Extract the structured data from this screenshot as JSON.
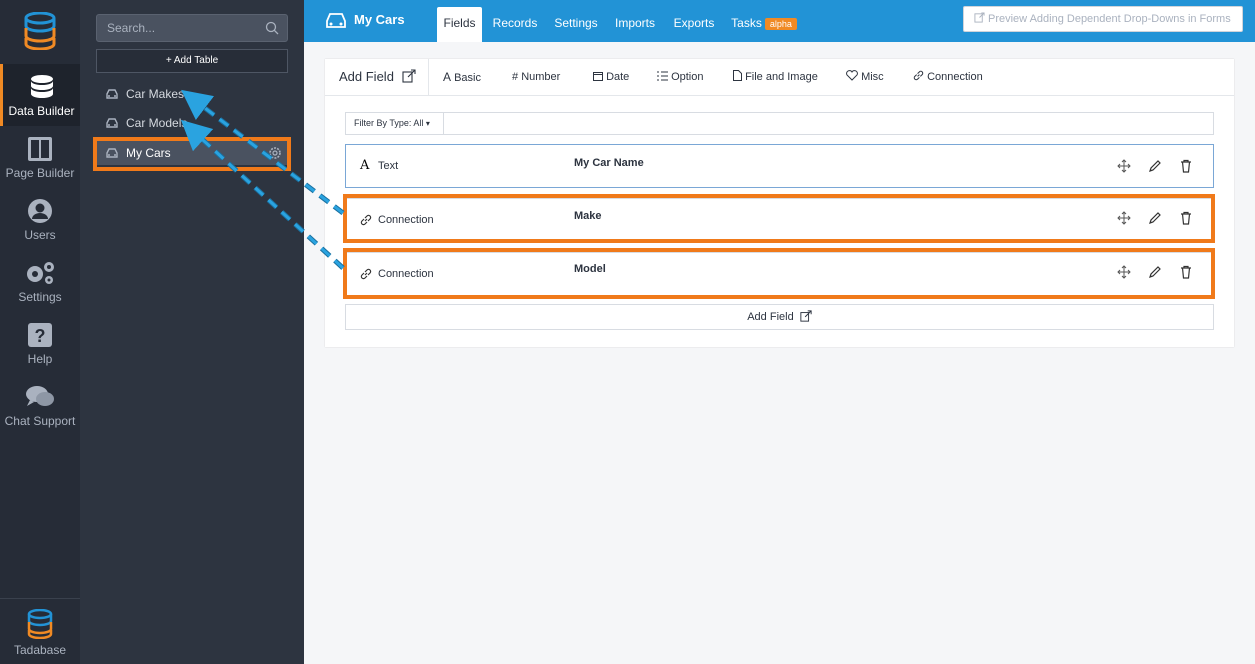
{
  "rail": {
    "items": [
      {
        "label": "Data Builder",
        "icon": "database-icon"
      },
      {
        "label": "Page Builder",
        "icon": "layout-icon"
      },
      {
        "label": "Users",
        "icon": "user-icon"
      },
      {
        "label": "Settings",
        "icon": "gears-icon"
      },
      {
        "label": "Help",
        "icon": "help-icon"
      },
      {
        "label": "Chat Support",
        "icon": "chat-icon"
      }
    ],
    "bottom_label": "Tadabase"
  },
  "sidebar": {
    "search_placeholder": "Search...",
    "add_table_label": "+ Add Table",
    "tables": [
      "Car Makes",
      "Car Models",
      "My Cars"
    ]
  },
  "topbar": {
    "table_title": "My Cars",
    "tabs": [
      "Fields",
      "Records",
      "Settings",
      "Imports",
      "Exports",
      "Tasks"
    ],
    "tasks_badge": "alpha",
    "preview_button": "Preview Adding Dependent Drop-Downs in Forms"
  },
  "toolbar": {
    "add_field_label": "Add Field",
    "types": [
      "Basic",
      "Number",
      "Date",
      "Option",
      "File and Image",
      "Misc",
      "Connection"
    ]
  },
  "filter": {
    "label": "Filter By Type: All"
  },
  "fields": [
    {
      "type": "Text",
      "name": "My Car Name"
    },
    {
      "type": "Connection",
      "name": "Make"
    },
    {
      "type": "Connection",
      "name": "Model"
    }
  ],
  "add_field_bottom": "Add Field",
  "colors": {
    "accent": "#2293d6",
    "highlight": "#f07a1a",
    "brand": "#f08a24"
  }
}
